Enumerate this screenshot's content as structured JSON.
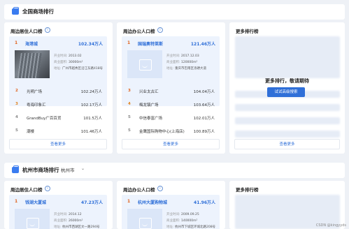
{
  "section1": {
    "title": "全国商场排行"
  },
  "section2": {
    "title": "杭州市商场排行",
    "city": "杭州市"
  },
  "labels": {
    "open_time": "开业时间:",
    "area": "商业面积:",
    "address": "地址:",
    "more": "查看更多",
    "info": "i"
  },
  "cards_top": [
    {
      "title": "周边居住人口榜",
      "top": {
        "rank": "1",
        "name": "海港城",
        "value": "102.34万人",
        "open_time": "2013.02",
        "area": "30000m²",
        "address": "广州市越秀区沿江东路418号"
      },
      "rows": [
        {
          "rank": "2",
          "name": "光明广场",
          "value": "102.24万人"
        },
        {
          "rank": "3",
          "name": "粤海印象汇",
          "value": "102.17万人"
        },
        {
          "rank": "4",
          "name": "GrandBuy广百百货",
          "value": "101.5万人"
        },
        {
          "rank": "5",
          "name": "潮楼",
          "value": "101.46万人"
        }
      ]
    },
    {
      "title": "周边办公人口榜",
      "top": {
        "rank": "1",
        "name": "国瑞奥特莱斯",
        "value": "121.46万人",
        "open_time": "2017.12.03",
        "area": "120000m²",
        "address": "重庆市巴南区洛碛大道"
      },
      "rows": [
        {
          "rank": "3",
          "name": "兴业太古汇",
          "value": "104.04万人"
        },
        {
          "rank": "4",
          "name": "梅龙镇广场",
          "value": "103.64万人"
        },
        {
          "rank": "5",
          "name": "中信泰富广场",
          "value": "102.01万人"
        },
        {
          "rank": "5",
          "name": "金鹰国际购物中心(上海店)",
          "value": "100.89万人"
        }
      ]
    }
  ],
  "more_top": {
    "title": "更多排行榜",
    "message": "更多排行，敬请期待",
    "button": "试试高级搜索"
  },
  "cards_bottom": [
    {
      "title": "周边居住人口榜",
      "top": {
        "rank": "1",
        "name": "钱湖大厦城",
        "value": "47.23万人",
        "open_time": "2014.12",
        "area": "26000m²",
        "address": "杭州市西湖区文一路294号"
      }
    },
    {
      "title": "周边办公人口榜",
      "top": {
        "rank": "1",
        "name": "杭州大厦购物城",
        "value": "41.96万人",
        "open_time": "2009.09.25",
        "area": "140000m²",
        "address": "杭州市下城区环城北路208号"
      }
    }
  ],
  "more_bottom": {
    "title": "更多排行榜"
  },
  "watermark": "CSDN @kingyyds"
}
